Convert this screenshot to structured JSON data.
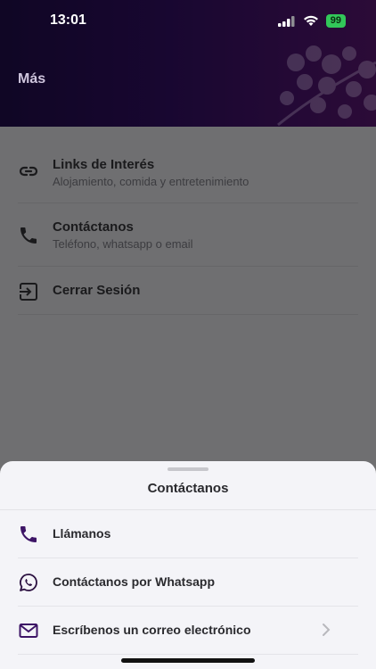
{
  "status": {
    "time": "13:01",
    "battery": "99"
  },
  "header": {
    "title": "Más"
  },
  "menu": {
    "items": [
      {
        "title": "Links de Interés",
        "subtitle": "Alojamiento, comida y entretenimiento",
        "icon": "link-icon"
      },
      {
        "title": "Contáctanos",
        "subtitle": "Teléfono, whatsapp o email",
        "icon": "phone-icon"
      },
      {
        "title": "Cerrar Sesión",
        "subtitle": "",
        "icon": "logout-icon"
      }
    ]
  },
  "sheet": {
    "title": "Contáctanos",
    "options": [
      {
        "label": "Llámanos",
        "icon": "phone-icon"
      },
      {
        "label": "Contáctanos por Whatsapp",
        "icon": "whatsapp-icon"
      },
      {
        "label": "Escríbenos un correo electrónico",
        "icon": "mail-icon"
      }
    ]
  },
  "colors": {
    "accent": "#3d1466",
    "header_start": "#1a0a3c",
    "header_end": "#47125a",
    "sheet_bg": "#f4f4f8"
  }
}
